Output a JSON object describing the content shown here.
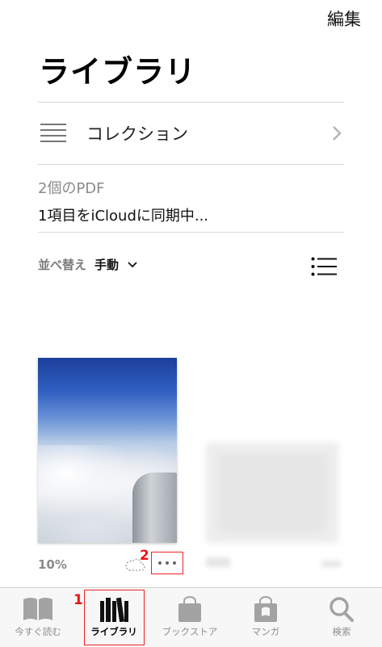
{
  "header": {
    "edit_label": "編集",
    "title": "ライブラリ"
  },
  "collection": {
    "label": "コレクション",
    "icon": "hamburger-list-icon",
    "chevron": "chevron-right-icon"
  },
  "status": {
    "pdf_count": "2個のPDF",
    "sync": "1項目をiCloudに同期中..."
  },
  "sort": {
    "label": "並べ替え",
    "value": "手動",
    "chevron": "chevron-down-icon",
    "view_icon": "list-view-icon"
  },
  "books": [
    {
      "progress": "10%",
      "cloud_icon": "cloud-dashed-icon",
      "more_icon": "ellipsis-icon"
    }
  ],
  "markers": {
    "m1": "1",
    "m2": "2"
  },
  "tabs": [
    {
      "label": "今すぐ読む",
      "icon": "open-book-icon",
      "active": false
    },
    {
      "label": "ライブラリ",
      "icon": "library-icon",
      "active": true
    },
    {
      "label": "ブックストア",
      "icon": "shopping-bag-icon",
      "active": false
    },
    {
      "label": "マンガ",
      "icon": "manga-bag-icon",
      "active": false
    },
    {
      "label": "検索",
      "icon": "search-icon",
      "active": false
    }
  ],
  "colors": {
    "accent_annotation": "#e22222",
    "inactive_tab": "#8f8f8f",
    "separator": "#d8d8d8"
  }
}
